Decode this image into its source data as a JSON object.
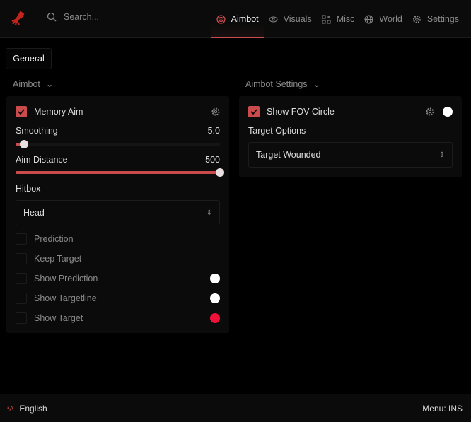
{
  "search": {
    "placeholder": "Search..."
  },
  "tabs": [
    {
      "label": "Aimbot",
      "icon": "target-icon"
    },
    {
      "label": "Visuals",
      "icon": "eye-icon"
    },
    {
      "label": "Misc",
      "icon": "grid-plus-icon"
    },
    {
      "label": "World",
      "icon": "globe-icon"
    },
    {
      "label": "Settings",
      "icon": "gear-icon"
    }
  ],
  "subtab": "General",
  "left": {
    "title": "Aimbot",
    "memory_aim": "Memory Aim",
    "smoothing": {
      "label": "Smoothing",
      "value": "5.0",
      "fraction": 0.04
    },
    "aim_distance": {
      "label": "Aim Distance",
      "value": "500",
      "fraction": 1.0
    },
    "hitbox": {
      "label": "Hitbox",
      "value": "Head"
    },
    "options": [
      {
        "label": "Prediction"
      },
      {
        "label": "Keep Target"
      },
      {
        "label": "Show Prediction",
        "color": "#ffffff"
      },
      {
        "label": "Show Targetline",
        "color": "#ffffff"
      },
      {
        "label": "Show Target",
        "color": "#f0103a"
      }
    ]
  },
  "right": {
    "title": "Aimbot Settings",
    "show_fov": "Show FOV Circle",
    "fov_color": "#ffffff",
    "target_options": {
      "label": "Target Options",
      "value": "Target Wounded"
    }
  },
  "footer": {
    "language": "English",
    "menu_key": "Menu: INS"
  },
  "colors": {
    "accent": "#c94b4b"
  }
}
